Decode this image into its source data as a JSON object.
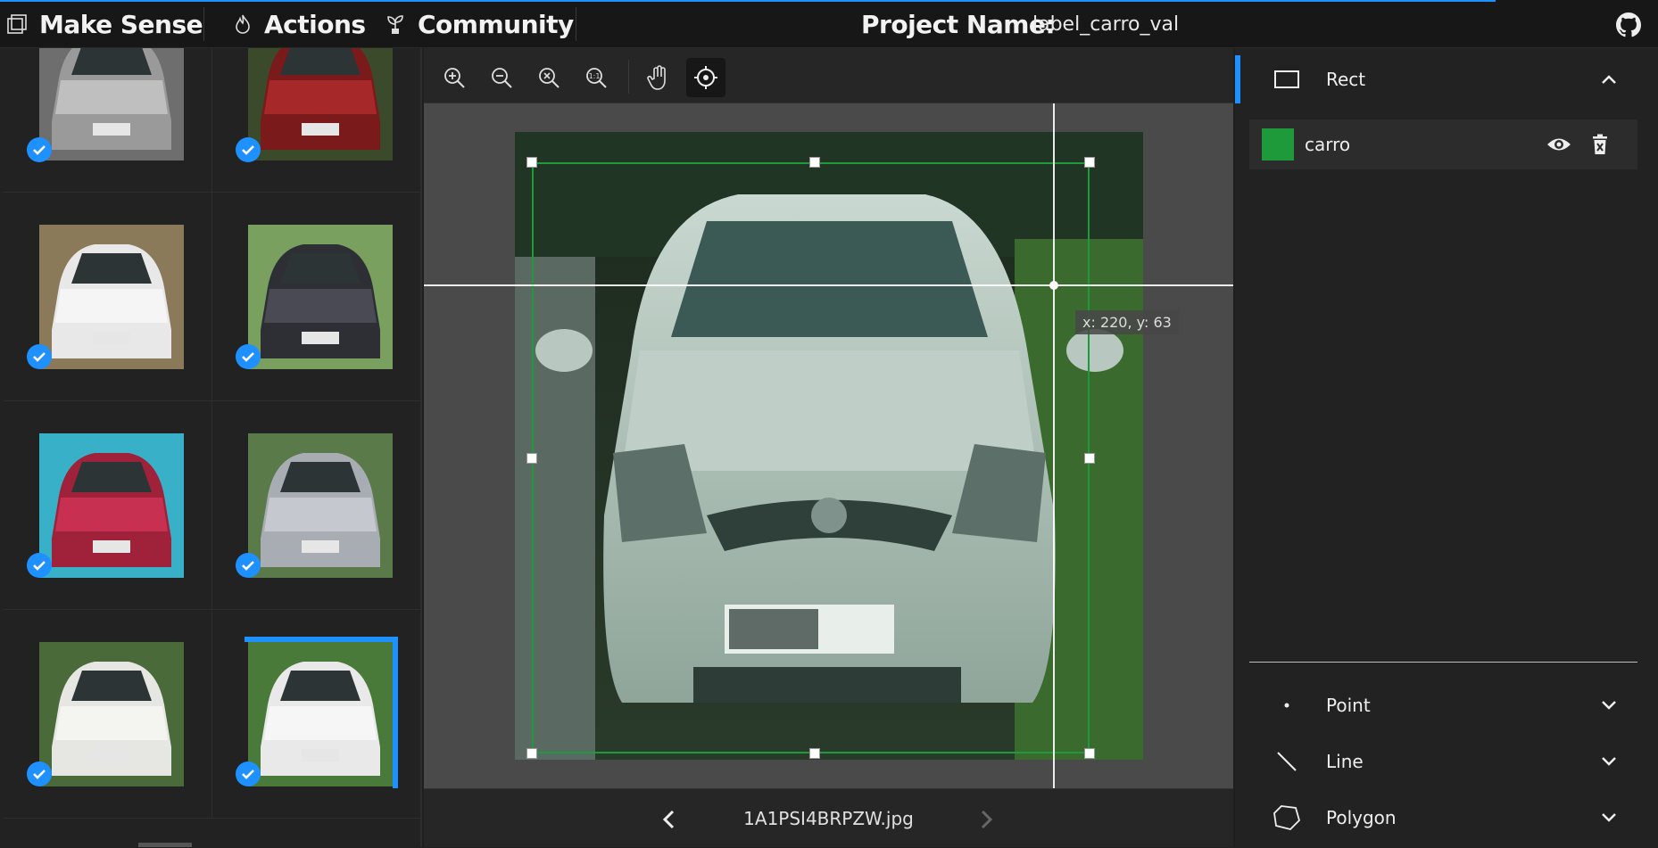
{
  "app": {
    "title": "Make Sense",
    "menu": [
      {
        "label": "Actions",
        "icon": "fire-icon"
      },
      {
        "label": "Community",
        "icon": "plant-icon"
      }
    ],
    "project_label": "Project Name:",
    "project_name": "label_carro_val",
    "accent_color": "#1e90ff"
  },
  "thumbnails": [
    {
      "name": "thumb-1",
      "checked": true,
      "palette": [
        "#9a9a9a",
        "#bfbfbf",
        "#6e6e6e"
      ]
    },
    {
      "name": "thumb-2",
      "checked": true,
      "palette": [
        "#7a1a1a",
        "#a62828",
        "#3a4a2a"
      ]
    },
    {
      "name": "thumb-3",
      "checked": true,
      "palette": [
        "#e8e8e8",
        "#f5f5f5",
        "#8a7a5a"
      ]
    },
    {
      "name": "thumb-4",
      "checked": true,
      "palette": [
        "#2e2e35",
        "#4a4a55",
        "#7aa060"
      ]
    },
    {
      "name": "thumb-5",
      "checked": true,
      "palette": [
        "#a0213a",
        "#c73050",
        "#38b0c8"
      ]
    },
    {
      "name": "thumb-6",
      "checked": true,
      "palette": [
        "#a8adb3",
        "#c5c9cf",
        "#5a7a4a"
      ]
    },
    {
      "name": "thumb-7",
      "checked": true,
      "palette": [
        "#e6e6e2",
        "#f4f4f0",
        "#4a6a3a"
      ]
    },
    {
      "name": "thumb-8",
      "checked": true,
      "palette": [
        "#e9e9e9",
        "#f6f6f6",
        "#4a7a3a"
      ],
      "active": true
    }
  ],
  "toolbar": {
    "tools": [
      "zoom-in-icon",
      "zoom-out-icon",
      "zoom-fit-icon",
      "zoom-actual-icon",
      "hand-icon",
      "crosshair-icon"
    ],
    "active_tool": "crosshair-icon"
  },
  "editor": {
    "cursor_readout": "x: 220, y: 63",
    "filename": "1A1PSI4BRPZW.jpg",
    "bbox_color": "#1f9a3a"
  },
  "right_panel": {
    "sections": [
      {
        "label": "Rect",
        "icon": "rect-icon",
        "expanded": true
      },
      {
        "label": "Point",
        "icon": "point-icon",
        "expanded": false
      },
      {
        "label": "Line",
        "icon": "line-icon",
        "expanded": false
      },
      {
        "label": "Polygon",
        "icon": "polygon-icon",
        "expanded": false
      }
    ],
    "labels": [
      {
        "name": "carro",
        "color": "#1f9a3a"
      }
    ]
  }
}
